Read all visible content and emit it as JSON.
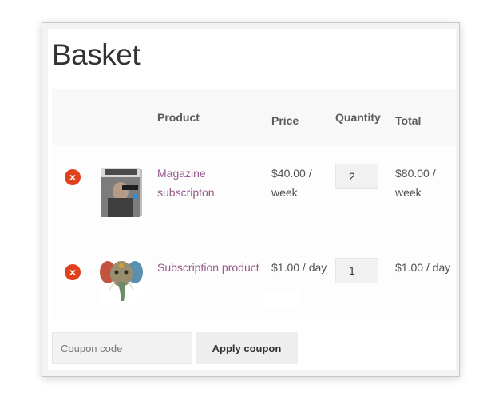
{
  "page": {
    "title": "Basket"
  },
  "table": {
    "headers": {
      "product": "Product",
      "price": "Price",
      "quantity": "Quantity",
      "total": "Total"
    },
    "rows": [
      {
        "product": "Magazine subscripton",
        "price": "$40.00 / week",
        "quantity": "2",
        "total": "$80.00 / week",
        "thumbnail_icon": "magazine-cover-icon"
      },
      {
        "product": "Subscription product",
        "price": "$1.00 / day",
        "quantity": "1",
        "total": "$1.00 / day",
        "thumbnail_icon": "elephant-art-icon"
      }
    ]
  },
  "coupon": {
    "placeholder": "Coupon code",
    "apply_label": "Apply coupon"
  },
  "colors": {
    "remove_icon": "#e2401c",
    "product_link": "#96588a"
  }
}
